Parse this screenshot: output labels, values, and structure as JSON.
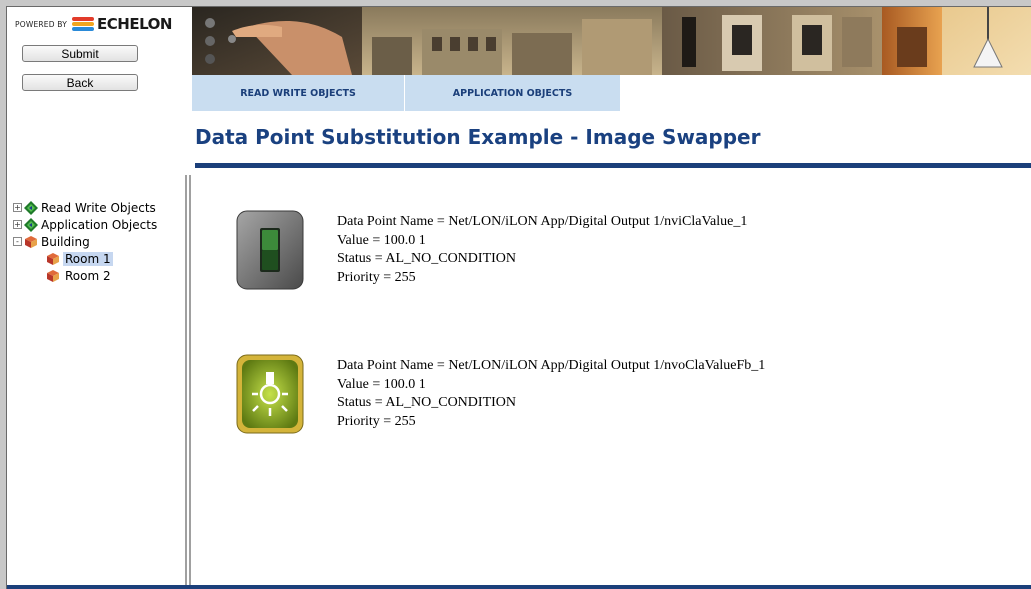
{
  "header": {
    "powered_by": "POWERED BY",
    "brand": "ECHELON"
  },
  "sidebar": {
    "buttons": [
      {
        "label": "Submit"
      },
      {
        "label": "Back"
      }
    ],
    "tree": [
      {
        "label": "Read Write Objects",
        "expander": "+",
        "icon": "diamond-icon"
      },
      {
        "label": "Application Objects",
        "expander": "+",
        "icon": "diamond-icon"
      },
      {
        "label": "Building",
        "expander": "-",
        "icon": "cube-icon"
      },
      {
        "label": "Room 1",
        "icon": "cube-icon",
        "selected": true
      },
      {
        "label": "Room 2",
        "icon": "cube-icon"
      }
    ]
  },
  "tabs": [
    {
      "label": "READ WRITE OBJECTS"
    },
    {
      "label": "APPLICATION OBJECTS"
    }
  ],
  "page": {
    "title": "Data Point Substitution Example - Image Swapper"
  },
  "datapoints": [
    {
      "icon": "toggle-switch-icon",
      "name": "Data Point Name = Net/LON/iLON App/Digital Output 1/nviClaValue_1",
      "value": "Value = 100.0 1",
      "status": "Status = AL_NO_CONDITION",
      "priority": "Priority = 255"
    },
    {
      "icon": "light-bulb-icon",
      "name": "Data Point Name = Net/LON/iLON App/Digital Output 1/nvoClaValueFb_1",
      "value": "Value = 100.0 1",
      "status": "Status = AL_NO_CONDITION",
      "priority": "Priority = 255"
    }
  ],
  "colors": {
    "accent": "#1b3f7a",
    "tab_bg": "#c9ddf0",
    "title": "#1a4180"
  }
}
